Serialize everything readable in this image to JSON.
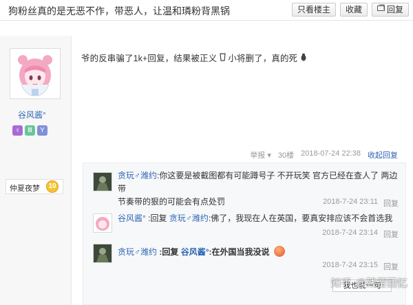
{
  "thread": {
    "title": "狗粉丝真的是无恶不作，带恶人，让温和璘粉背黑锅"
  },
  "toolbar": {
    "only_op_label": "只看楼主",
    "collect_label": "收藏",
    "reply_label": "回复"
  },
  "author": {
    "name": "谷风酱°",
    "forum_name": "仲夏夜梦",
    "level": "10",
    "badges": [
      "♀",
      "Ⅲ",
      "Y"
    ]
  },
  "post": {
    "content_a": "爷的反串骗了1k+回复，结果被正义",
    "content_b": "小将删了，真的死",
    "report_label": "举报",
    "floor": "30楼",
    "time": "2018-07-24 22:38",
    "collapse_label": "收起回复"
  },
  "comments": [
    {
      "user": "贪玩♂潍约",
      "text_line1": ":你这要是被截图都有可能蹲号子 不开玩笑 官方已经在查人了 两边带",
      "text_line2": "节奏带的狠的可能会有点处罚",
      "time": "2018-7-24 23:11",
      "reply_label": "回复"
    },
    {
      "user": "谷风酱°",
      "reply_prefix": ":回复",
      "target": "贪玩♂潍约",
      "text": ":佛了，我现在人在英国，要真安排应该不会首选我",
      "time": "2018-7-24 23:14",
      "reply_label": "回复"
    },
    {
      "user": "贪玩♂潍约",
      "reply_prefix": ":回复",
      "target": "谷风酱°",
      "text": ":在外国当我没说",
      "time": "2018-7-24 23:15",
      "reply_label": "回复"
    }
  ],
  "more_label": "我也说一句",
  "watermark": {
    "site": "知乎",
    "author": "@残留回忆"
  }
}
